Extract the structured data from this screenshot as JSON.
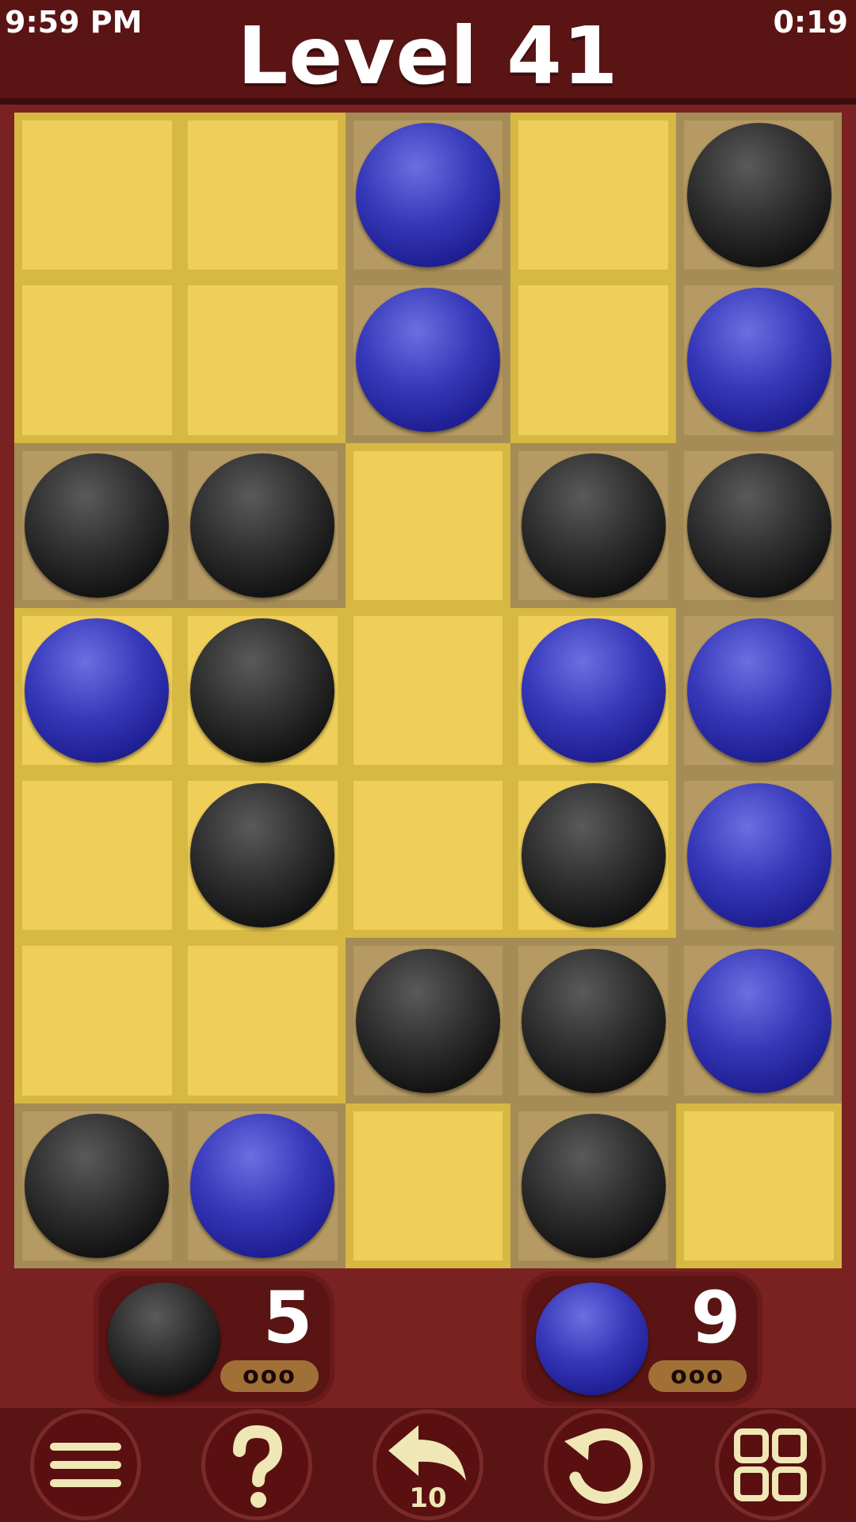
{
  "status_bar": {
    "time": "9:59 PM",
    "timer": "0:19"
  },
  "header": {
    "title": "Level 41"
  },
  "colors": {
    "cell_light": "#efcf5a",
    "cell_tan": "#b69a63",
    "ball_black": "#1a1a1a",
    "ball_blue": "#2a2ab0",
    "background": "#7a2222",
    "bar": "#5a1414"
  },
  "board": {
    "columns": 5,
    "rows": 7,
    "cells": [
      [
        {
          "tan": false,
          "ball": null
        },
        {
          "tan": false,
          "ball": null
        },
        {
          "tan": true,
          "ball": "blue"
        },
        {
          "tan": false,
          "ball": null
        },
        {
          "tan": true,
          "ball": "black"
        }
      ],
      [
        {
          "tan": false,
          "ball": null
        },
        {
          "tan": false,
          "ball": null
        },
        {
          "tan": true,
          "ball": "blue"
        },
        {
          "tan": false,
          "ball": null
        },
        {
          "tan": true,
          "ball": "blue"
        }
      ],
      [
        {
          "tan": true,
          "ball": "black"
        },
        {
          "tan": true,
          "ball": "black"
        },
        {
          "tan": false,
          "ball": null
        },
        {
          "tan": true,
          "ball": "black"
        },
        {
          "tan": true,
          "ball": "black"
        }
      ],
      [
        {
          "tan": false,
          "ball": "blue"
        },
        {
          "tan": false,
          "ball": "black"
        },
        {
          "tan": false,
          "ball": null
        },
        {
          "tan": false,
          "ball": "blue"
        },
        {
          "tan": true,
          "ball": "blue"
        }
      ],
      [
        {
          "tan": false,
          "ball": null
        },
        {
          "tan": false,
          "ball": "black"
        },
        {
          "tan": false,
          "ball": null
        },
        {
          "tan": false,
          "ball": "black"
        },
        {
          "tan": true,
          "ball": "blue"
        }
      ],
      [
        {
          "tan": false,
          "ball": null
        },
        {
          "tan": false,
          "ball": null
        },
        {
          "tan": true,
          "ball": "black"
        },
        {
          "tan": true,
          "ball": "black"
        },
        {
          "tan": true,
          "ball": "blue"
        }
      ],
      [
        {
          "tan": true,
          "ball": "black"
        },
        {
          "tan": true,
          "ball": "blue"
        },
        {
          "tan": false,
          "ball": null
        },
        {
          "tan": true,
          "ball": "black"
        },
        {
          "tan": false,
          "ball": null
        }
      ]
    ]
  },
  "scores": {
    "black": {
      "count": "5",
      "dots": "ooo"
    },
    "blue": {
      "count": "9",
      "dots": "ooo"
    }
  },
  "toolbar": {
    "menu_icon": "hamburger-icon",
    "help_icon": "question-icon",
    "undo_icon": "undo-arrow-icon",
    "undo_count": "10",
    "restart_icon": "restart-icon",
    "levels_icon": "grid-icon"
  }
}
